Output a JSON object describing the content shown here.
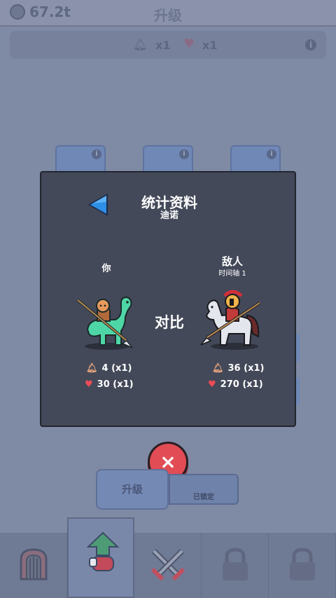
{
  "topbar": {
    "currency": "67.2t",
    "title": "升级"
  },
  "statsbar": {
    "bell_count": "x1",
    "heart_count": "x1",
    "info": "i"
  },
  "cards": {
    "info": "i"
  },
  "modal": {
    "title": "统计资料",
    "subtitle": "迪诺",
    "you_label": "你",
    "enemy_label": "敌人",
    "enemy_sub": "时间轴 1",
    "vs_label": "对比",
    "you_stats": {
      "attack": "4 (x1)",
      "health": "30 (x1)"
    },
    "enemy_stats": {
      "attack": "36 (x1)",
      "health": "270 (x1)"
    }
  },
  "buttons": {
    "close": "×",
    "upgrade": "升级",
    "locked": "已锁定"
  },
  "nav": {
    "items": [
      {
        "id": "castle",
        "icon": "castle-gate-icon"
      },
      {
        "id": "upgrade",
        "icon": "upgrade-arrow-icon"
      },
      {
        "id": "battle",
        "icon": "crossed-swords-icon"
      },
      {
        "id": "locked-1",
        "icon": "lock-icon"
      },
      {
        "id": "locked-2",
        "icon": "lock-icon"
      }
    ]
  },
  "colors": {
    "modal_bg": "#434959",
    "accent_blue": "#2e8fe6",
    "close_red": "#e14c55",
    "dim_bg": "#7f8aa4"
  }
}
